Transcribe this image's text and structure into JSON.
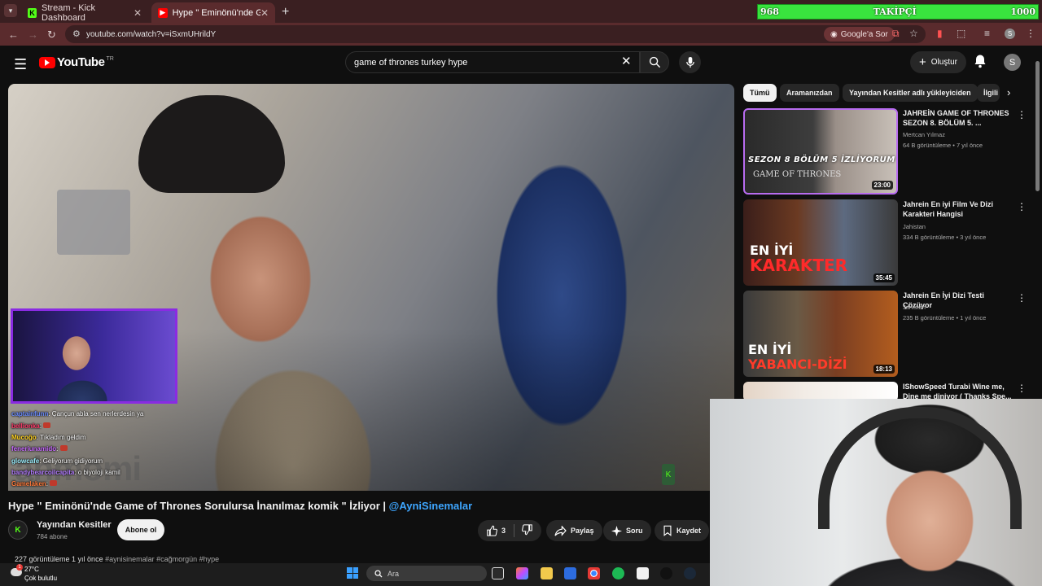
{
  "browser": {
    "tabs": [
      {
        "title": "Stream - Kick Dashboard",
        "favicon": "K",
        "color": "#53fc18"
      },
      {
        "title": "Hype \" Eminönü'nde Game of T",
        "favicon": "▶",
        "color": "#ff0000"
      }
    ],
    "url": "youtube.com/watch?v=iSxmUHrildY",
    "google_sor": "Google'a Sor"
  },
  "follower_goal": {
    "current": "968",
    "label": "TAKİPÇİ",
    "target": "1000",
    "progress": 0.968
  },
  "youtube": {
    "logo": "YouTube",
    "logo_region": "TR",
    "search_query": "game of thrones  turkey hype",
    "create_label": "Oluştur",
    "avatar_letter": "S"
  },
  "stream_chat": [
    {
      "user": "captainfunn",
      "msg": "Çançun abla sen nerlerdesin ya",
      "user_color": "#6b8cff"
    },
    {
      "user": "bellionka",
      "msg": "",
      "user_color": "#ff3b6b"
    },
    {
      "user": "Mucoğo",
      "msg": "Tıkladım geldim",
      "user_color": "#ffd21f"
    },
    {
      "user": "feneriunamido",
      "msg": "",
      "user_color": "#c86bff"
    },
    {
      "user": "glowcafe",
      "msg": "Geliyorum gidiyorum",
      "user_color": "#9cf0ff"
    },
    {
      "user": "bandybearcoilcapita",
      "msg": "o biyoloji kamil",
      "user_color": "#b27bff"
    },
    {
      "user": "Gamelaken",
      "msg": "",
      "user_color": "#ff7a3b"
    }
  ],
  "kick_watermark": "ahmomi",
  "video": {
    "title": "Hype \" Eminönü'nde Game of Thrones Sorulursa İnanılmaz komik \" İzliyor | ",
    "title_tag": "@AyniSinemalar",
    "channel": "Yayından Kesitler",
    "subscribers": "784 abone",
    "subscribe_label": "Abone ol",
    "likes": "3",
    "share_label": "Paylaş",
    "ask_label": "Soru",
    "save_label": "Kaydet",
    "views": "227 görüntüleme  1 yıl önce",
    "hashtags": "#aynisinemalar #cağmorgün #hype"
  },
  "chips": [
    "Tümü",
    "Aramanızdan",
    "Yayından Kesitler adlı yükleyiciden",
    "İlgili"
  ],
  "related": [
    {
      "title": "JAHREİN GAME OF THRONES SEZON 8. BÖLÜM 5. ...",
      "channel": "Mertcan Yılmaz",
      "meta": "64 B görüntüleme • 7 yıl önce",
      "duration": "23:00",
      "thumb_text": "SEZON 8 BÖLÜM 5 İZLİYORUM",
      "thumb_text2": "GAME OF THRONES"
    },
    {
      "title": "Jahrein En iyi Film Ve Dizi Karakteri Hangisi",
      "channel": "Jahistan",
      "meta": "334 B görüntüleme • 3 yıl önce",
      "duration": "35:45",
      "thumb_text": "EN İYİ",
      "thumb_text2": "KARAKTER"
    },
    {
      "title": "Jahrein En İyi Dizi Testi Çözüyor",
      "channel": "Jahistan",
      "meta": "235 B görüntüleme • 1 yıl önce",
      "duration": "18:13",
      "thumb_text": "EN İYİ",
      "thumb_text2": "YABANCI-DİZİ"
    },
    {
      "title": "IShowSpeed Turabi Wine me, Dine me diniyor ( Thanks Spe...",
      "channel": "",
      "meta": "",
      "duration": "",
      "thumb_text": "",
      "thumb_text2": ""
    }
  ],
  "taskbar": {
    "temperature": "27°C",
    "weather": "Çok bulutlu",
    "weather_badge": "1",
    "search_placeholder": "Ara"
  }
}
